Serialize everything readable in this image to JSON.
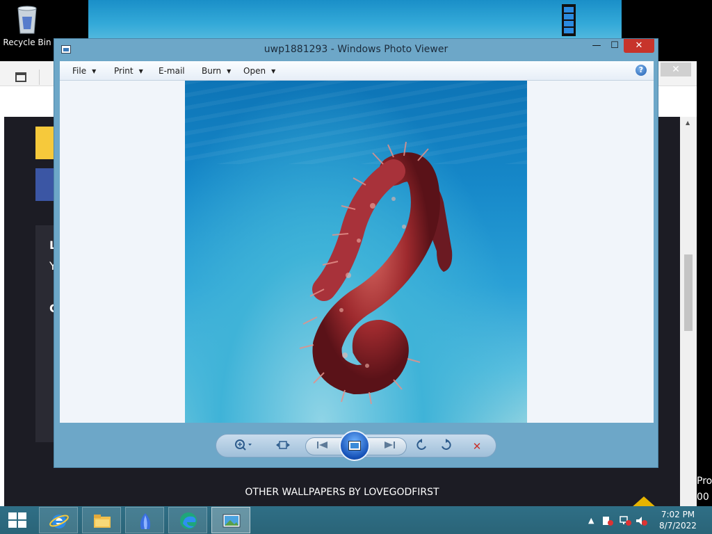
{
  "desktop": {
    "recycle_bin_label": "Recycle Bin"
  },
  "browser": {
    "close_glyph": "✕",
    "more_glyph": "···",
    "back_glyph": "←",
    "site_letters": [
      "L",
      "Y",
      "C"
    ],
    "other_wallpapers": "OTHER WALLPAPERS BY LOVEGODFIRST",
    "edge_peek": [
      "Pro",
      "00"
    ]
  },
  "photo_viewer": {
    "title": "uwp1881293 - Windows Photo Viewer",
    "window_buttons": {
      "minimize": "—",
      "maximize": "☐",
      "close": "✕"
    },
    "menus": [
      {
        "label": "File",
        "has_dropdown": true
      },
      {
        "label": "Print",
        "has_dropdown": true
      },
      {
        "label": "E-mail",
        "has_dropdown": false
      },
      {
        "label": "Burn",
        "has_dropdown": true
      },
      {
        "label": "Open",
        "has_dropdown": true
      }
    ],
    "help_glyph": "?",
    "controls": {
      "zoom_icon": "zoom-icon",
      "actual_size_icon": "actual-size-icon",
      "previous_icon": "previous-icon",
      "slideshow_icon": "slideshow-icon",
      "next_icon": "next-icon",
      "rotate_ccw_icon": "rotate-ccw-icon",
      "rotate_cw_icon": "rotate-cw-icon",
      "delete_icon": "delete-icon"
    },
    "photo_subject": "seahorse-photo"
  },
  "taskbar": {
    "apps": [
      {
        "name": "internet-explorer-icon",
        "active": false
      },
      {
        "name": "file-explorer-icon",
        "active": false
      },
      {
        "name": "app-icon",
        "active": false
      },
      {
        "name": "edge-icon",
        "active": false
      },
      {
        "name": "photo-viewer-icon",
        "active": true
      }
    ],
    "time": "7:02 PM",
    "date": "8/7/2022",
    "colors": {
      "accent": "#2a6478"
    }
  }
}
